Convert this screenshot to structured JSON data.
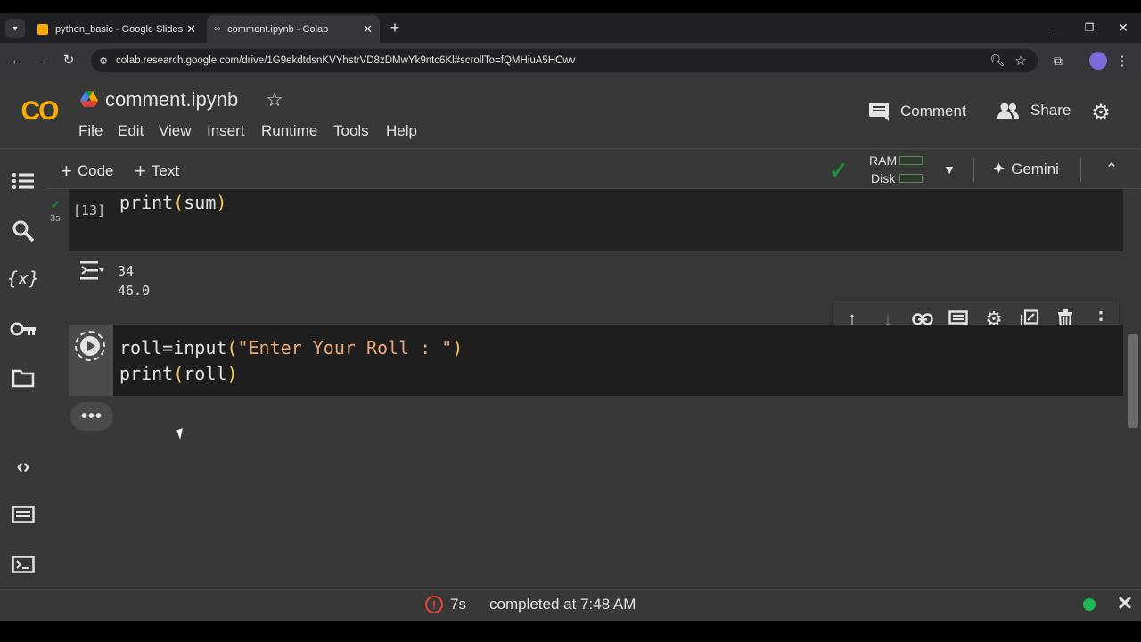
{
  "browser": {
    "tabs": [
      {
        "title": "python_basic - Google Slides"
      },
      {
        "title": "comment.ipynb - Colab"
      }
    ],
    "url": "colab.research.google.com/drive/1G9ekdtdsnKVYhstrVD8zDMwYk9ntc6Kl#scrollTo=fQMHiuA5HCwv"
  },
  "colab": {
    "logo": "CO",
    "filename": "comment.ipynb",
    "menu": [
      "File",
      "Edit",
      "View",
      "Insert",
      "Runtime",
      "Tools",
      "Help"
    ],
    "comment_label": "Comment",
    "share_label": "Share",
    "add_code_label": "Code",
    "add_text_label": "Text",
    "ram_label": "RAM",
    "disk_label": "Disk",
    "gemini_label": "Gemini"
  },
  "cells": [
    {
      "exec_count": "[13]",
      "exec_time": "3s",
      "code_fn": "print",
      "code_arg": "sum",
      "output": [
        "34",
        "46.0"
      ]
    },
    {
      "line1_var": "roll=input",
      "line1_str": "\"Enter Your Roll : \"",
      "line2_fn": "print",
      "line2_arg": "roll"
    }
  ],
  "status": {
    "elapsed": "7s",
    "message": "completed at 7:48 AM"
  },
  "colors": {
    "accent_green": "#1e8e3e",
    "orange_logo": "#f9ab00",
    "paren": "#f9c74f",
    "string": "#e9a979"
  }
}
